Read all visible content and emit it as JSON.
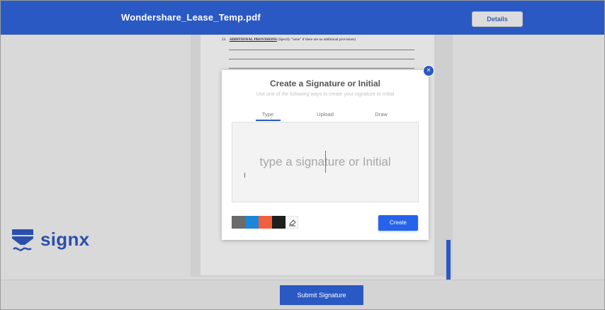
{
  "header": {
    "document_title": "Wondershare_Lease_Temp.pdf",
    "details_label": "Details"
  },
  "document": {
    "section_number": "23.",
    "section_heading": "ADDITIONAL PROVISIONS",
    "section_note": "(Specify \"none\" if there are no additional provisions)"
  },
  "modal": {
    "title": "Create a Signature or Initial",
    "subtitle": "Use one of the following ways to create your signature or Initial",
    "tabs": [
      {
        "label": "Type",
        "active": true
      },
      {
        "label": "Upload",
        "active": false
      },
      {
        "label": "Draw",
        "active": false
      }
    ],
    "signature_placeholder": "type a signature or Initial",
    "colors": [
      "#6b6b6b",
      "#1b87d6",
      "#f0603e",
      "#1f1f1f"
    ],
    "eraser_icon": "eraser-icon",
    "create_label": "Create",
    "close_icon": "close-icon"
  },
  "brand": {
    "name": "signx",
    "color": "#2b4fae"
  },
  "footer": {
    "submit_label": "Submit Signature"
  },
  "theme": {
    "primary": "#2b59c3"
  }
}
